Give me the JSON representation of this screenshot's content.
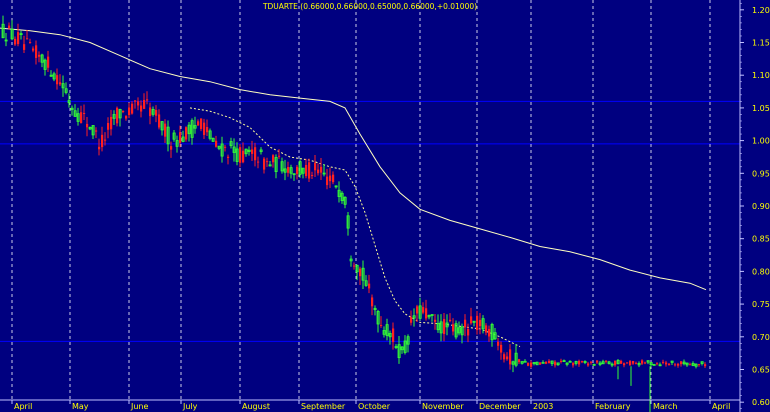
{
  "chart_data": {
    "type": "candlestick",
    "title": "TDUARTE (0.66000,0.66000,0.65000,0.66000,+0.01000)",
    "ylim": [
      0.585,
      1.215
    ],
    "y_ticks": [
      "1.20",
      "1.15",
      "1.10",
      "1.05",
      "1.00",
      "0.95",
      "0.90",
      "0.85",
      "0.80",
      "0.75",
      "0.70",
      "0.65",
      "0.60"
    ],
    "x_ticks": [
      "April",
      "May",
      "June",
      "July",
      "August",
      "September",
      "October",
      "November",
      "December",
      "2003",
      "February",
      "March",
      "April"
    ],
    "horizontal_lines": [
      1.06,
      0.995,
      0.693
    ],
    "colors": {
      "background": "#000080",
      "up": "#33ff33",
      "down": "#ff2020",
      "text": "#ffff00",
      "ma_long": "#ffffc0",
      "ma_short": "#ffff99",
      "grid": "#c0c0ff",
      "hline": "#0000ff"
    },
    "anchors": [
      [
        0,
        1.17
      ],
      [
        14,
        1.16
      ],
      [
        28,
        1.14
      ],
      [
        45,
        1.12
      ],
      [
        60,
        1.09
      ],
      [
        72,
        1.05
      ],
      [
        86,
        1.03
      ],
      [
        100,
        0.995
      ],
      [
        115,
        1.04
      ],
      [
        130,
        1.045
      ],
      [
        145,
        1.055
      ],
      [
        160,
        1.025
      ],
      [
        170,
        1.0
      ],
      [
        185,
        1.01
      ],
      [
        200,
        1.03
      ],
      [
        215,
        0.99
      ],
      [
        230,
        0.985
      ],
      [
        245,
        0.975
      ],
      [
        255,
        0.98
      ],
      [
        265,
        0.965
      ],
      [
        280,
        0.965
      ],
      [
        295,
        0.955
      ],
      [
        310,
        0.955
      ],
      [
        325,
        0.945
      ],
      [
        335,
        0.935
      ],
      [
        345,
        0.91
      ],
      [
        350,
        0.83
      ],
      [
        360,
        0.8
      ],
      [
        370,
        0.76
      ],
      [
        380,
        0.72
      ],
      [
        392,
        0.7
      ],
      [
        402,
        0.67
      ],
      [
        412,
        0.73
      ],
      [
        422,
        0.74
      ],
      [
        432,
        0.72
      ],
      [
        445,
        0.715
      ],
      [
        460,
        0.71
      ],
      [
        472,
        0.72
      ],
      [
        485,
        0.715
      ],
      [
        497,
        0.7
      ],
      [
        505,
        0.67
      ],
      [
        515,
        0.665
      ],
      [
        530,
        0.658
      ],
      [
        550,
        0.66
      ],
      [
        580,
        0.66
      ],
      [
        610,
        0.66
      ],
      [
        640,
        0.66
      ],
      [
        670,
        0.66
      ],
      [
        705,
        0.658
      ]
    ],
    "ma_long": [
      [
        0,
        1.172
      ],
      [
        30,
        1.168
      ],
      [
        60,
        1.162
      ],
      [
        90,
        1.15
      ],
      [
        120,
        1.13
      ],
      [
        150,
        1.11
      ],
      [
        180,
        1.098
      ],
      [
        210,
        1.09
      ],
      [
        240,
        1.078
      ],
      [
        270,
        1.07
      ],
      [
        300,
        1.065
      ],
      [
        330,
        1.06
      ],
      [
        345,
        1.05
      ],
      [
        360,
        1.01
      ],
      [
        380,
        0.96
      ],
      [
        400,
        0.92
      ],
      [
        420,
        0.895
      ],
      [
        450,
        0.878
      ],
      [
        480,
        0.865
      ],
      [
        510,
        0.852
      ],
      [
        540,
        0.838
      ],
      [
        570,
        0.83
      ],
      [
        600,
        0.818
      ],
      [
        630,
        0.802
      ],
      [
        660,
        0.79
      ],
      [
        690,
        0.782
      ],
      [
        706,
        0.772
      ]
    ],
    "ma_short": [
      [
        190,
        1.05
      ],
      [
        210,
        1.045
      ],
      [
        230,
        1.035
      ],
      [
        250,
        1.02
      ],
      [
        270,
        0.99
      ],
      [
        290,
        0.975
      ],
      [
        310,
        0.97
      ],
      [
        330,
        0.96
      ],
      [
        345,
        0.955
      ],
      [
        355,
        0.93
      ],
      [
        365,
        0.89
      ],
      [
        375,
        0.84
      ],
      [
        385,
        0.79
      ],
      [
        395,
        0.755
      ],
      [
        405,
        0.735
      ],
      [
        420,
        0.722
      ],
      [
        440,
        0.72
      ],
      [
        460,
        0.716
      ],
      [
        480,
        0.712
      ],
      [
        500,
        0.7
      ],
      [
        520,
        0.685
      ]
    ],
    "spikes_down": [
      [
        618,
        0.635
      ],
      [
        631,
        0.625
      ],
      [
        650,
        0.585
      ]
    ]
  }
}
